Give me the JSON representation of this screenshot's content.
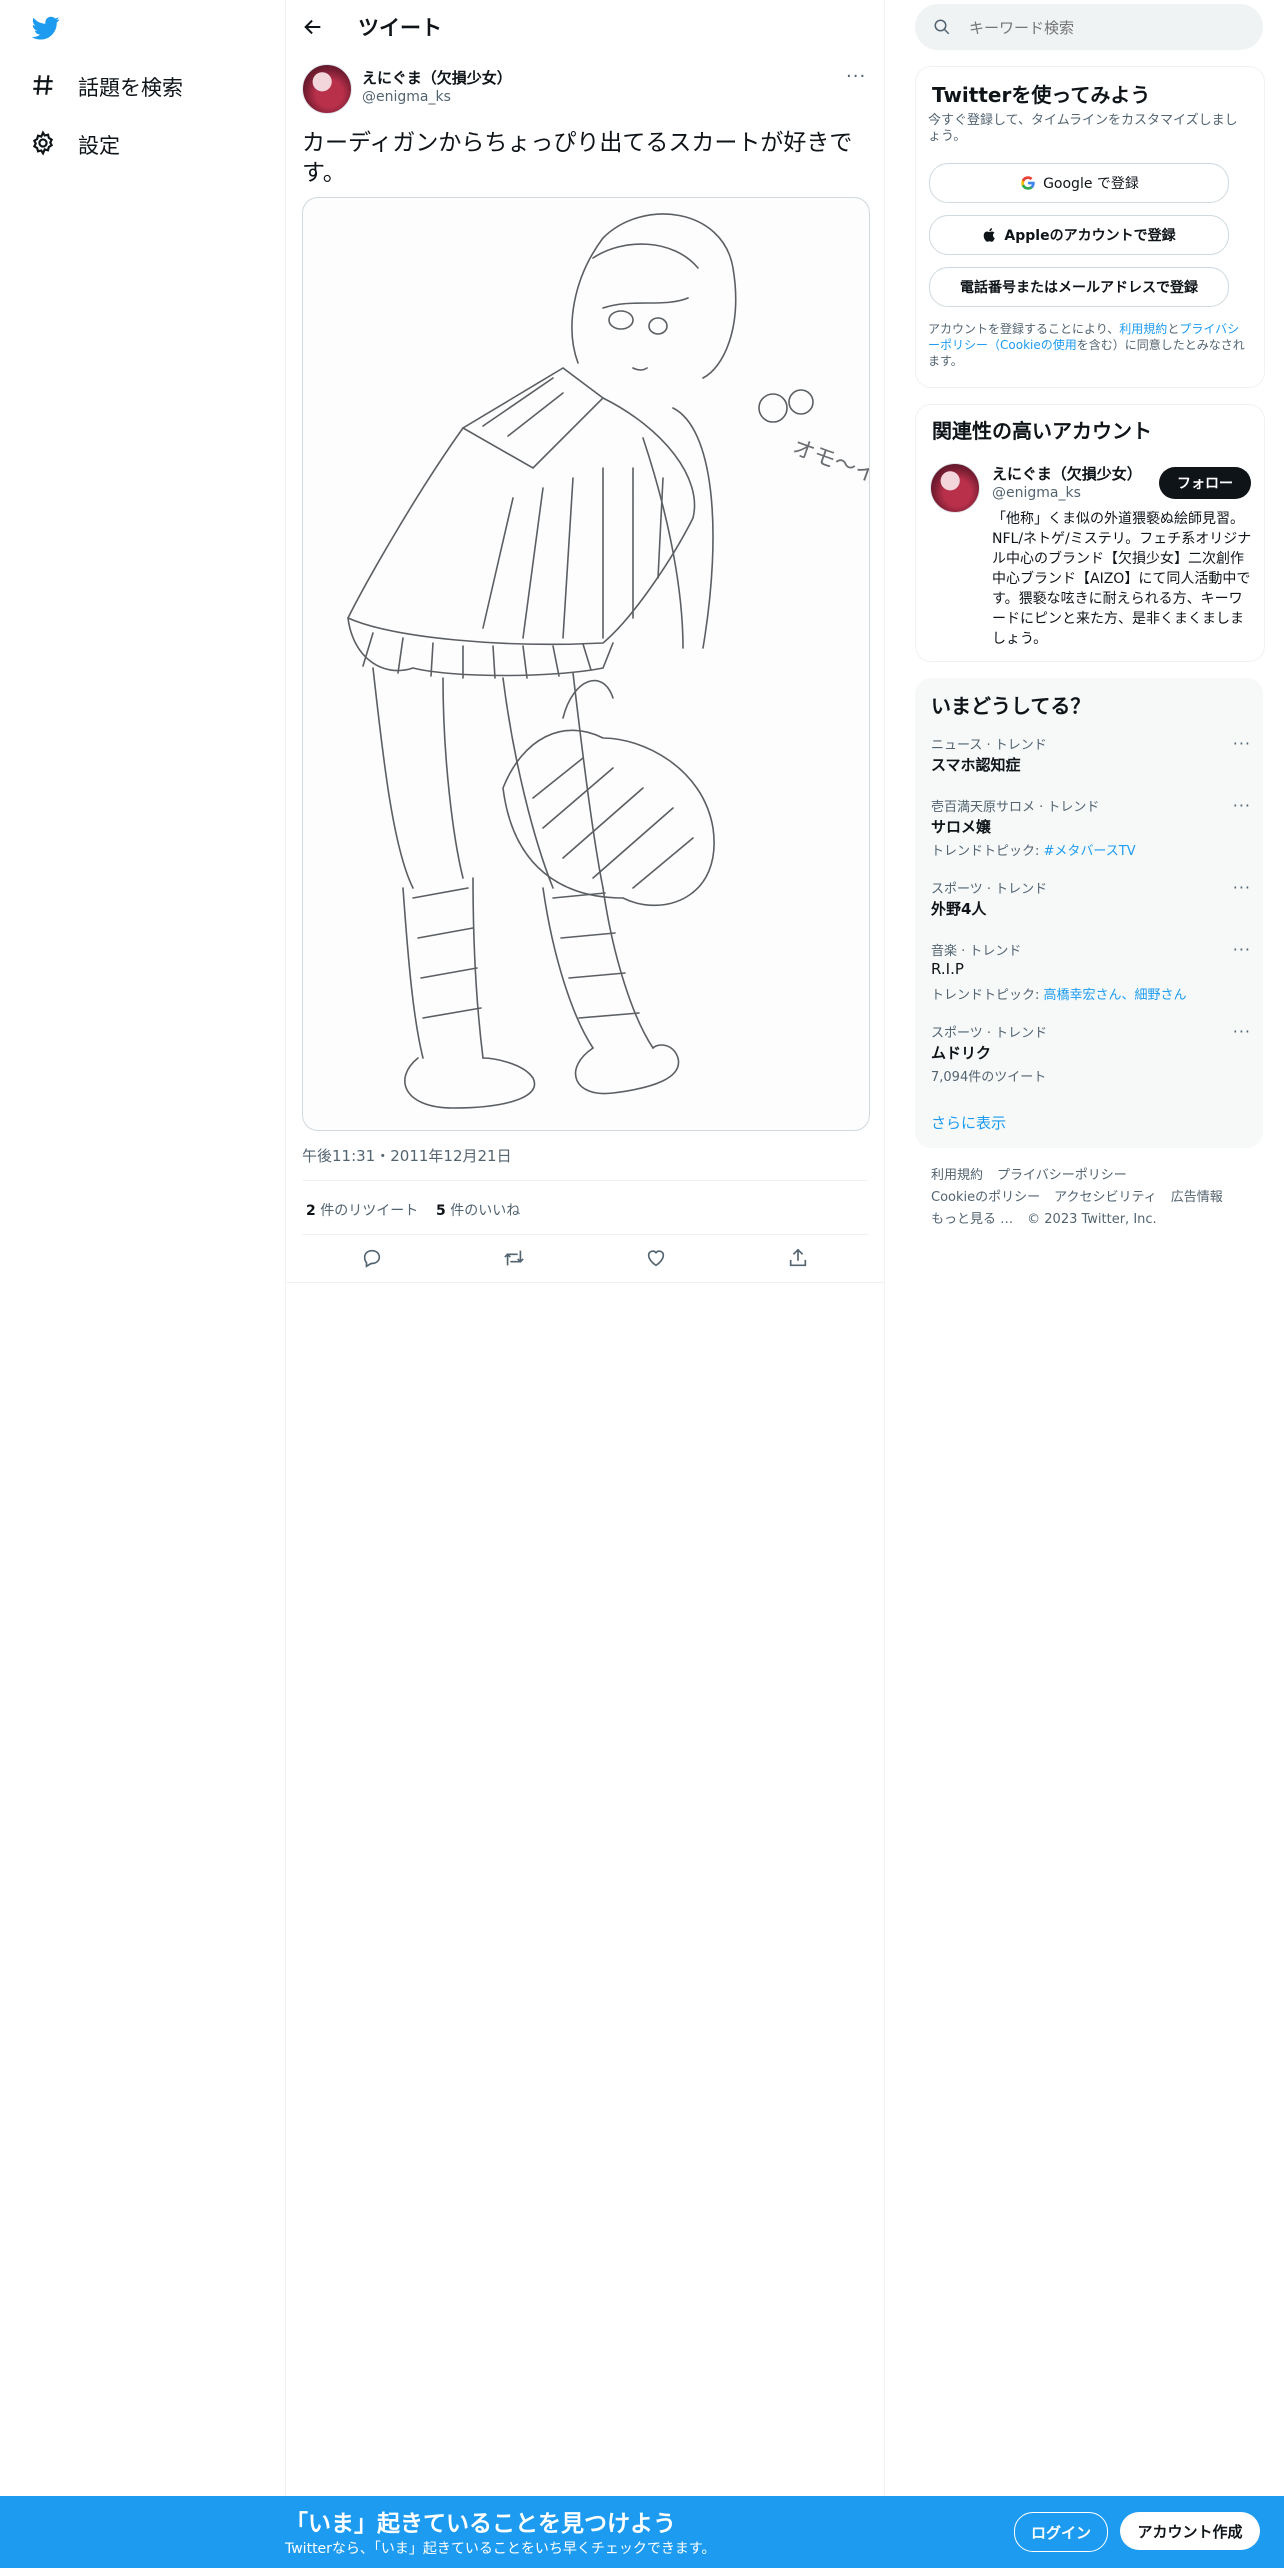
{
  "nav": {
    "explore_label": "話題を検索",
    "settings_label": "設定"
  },
  "header": {
    "title": "ツイート"
  },
  "tweet": {
    "author_name": "えにぐま（欠損少女）",
    "author_handle": "@enigma_ks",
    "text": "カーディガンからちょっぴり出てるスカートが好きです。",
    "image_text": "オモ〜イ",
    "time": "午後11:31・2011年12月21日",
    "retweets_count": "2",
    "retweets_label": " 件のリツイート",
    "likes_count": "5",
    "likes_label": " 件のいいね"
  },
  "search": {
    "placeholder": "キーワード検索"
  },
  "signup": {
    "title": "Twitterを使ってみよう",
    "subtitle": "今すぐ登録して、タイムラインをカスタマイズしましょう。",
    "google_label": "Google で登録",
    "apple_label": "Appleのアカウントで登録",
    "phone_label": "電話番号またはメールアドレスで登録",
    "terms_prefix": "アカウントを登録することにより、",
    "terms_link": "利用規約",
    "terms_and": "と",
    "privacy_link": "プライバシーポリシー",
    "cookie_link": "（Cookieの使用",
    "terms_suffix": "を含む）に同意したとみなされます。"
  },
  "relevant": {
    "title": "関連性の高いアカウント",
    "name": "えにぐま（欠損少女）",
    "handle": "@enigma_ks",
    "follow_label": "フォロー",
    "bio": "「他称」くま似の外道猥褻ぬ絵師見習。NFL/ネトゲ/ミステリ。フェチ系オリジナル中心のブランド【欠損少女】二次創作中心ブランド【AIZO】にて同人活動中です。猥褻な呟きに耐えられる方、キーワードにピンと来た方、是非くまくましましょう。"
  },
  "trends": {
    "title": "いまどうしてる？",
    "items": [
      {
        "category": "ニュース · トレンド",
        "name": "スマホ認知症",
        "sub_prefix": "",
        "sub_link": ""
      },
      {
        "category": "壱百満天原サロメ · トレンド",
        "name": "サロメ嬢",
        "sub_prefix": "トレンドトピック: ",
        "sub_link": "#メタバースTV"
      },
      {
        "category": "スポーツ · トレンド",
        "name": "外野4人",
        "sub_prefix": "",
        "sub_link": ""
      },
      {
        "category": "音楽 · トレンド",
        "name": "R.I.P",
        "sub_prefix": "トレンドトピック: ",
        "sub_link": "高橋幸宏さん、細野さん"
      },
      {
        "category": "スポーツ · トレンド",
        "name": "ムドリク",
        "sub_prefix": "7,094件のツイート",
        "sub_link": ""
      }
    ],
    "show_more": "さらに表示"
  },
  "footer": {
    "terms": "利用規約",
    "privacy": "プライバシーポリシー",
    "cookie": "Cookieのポリシー",
    "accessibility": "アクセシビリティ",
    "ads": "広告情報",
    "more": "もっと見る …",
    "copyright": "© 2023 Twitter, Inc."
  },
  "bottom_bar": {
    "title": "「いま」起きていることを見つけよう",
    "subtitle": "Twitterなら、「いま」起きていることをいち早くチェックできます。",
    "login_label": "ログイン",
    "signup_label": "アカウント作成"
  },
  "colors": {
    "accent": "#1d9bf0",
    "text": "#0f1419",
    "muted": "#536471",
    "panel": "#f7f9f9"
  },
  "icons": [
    "twitter-logo-icon",
    "hashtag-icon",
    "gear-icon",
    "back-arrow-icon",
    "more-icon",
    "reply-icon",
    "retweet-icon",
    "like-icon",
    "share-icon",
    "search-icon",
    "google-icon",
    "apple-icon"
  ]
}
